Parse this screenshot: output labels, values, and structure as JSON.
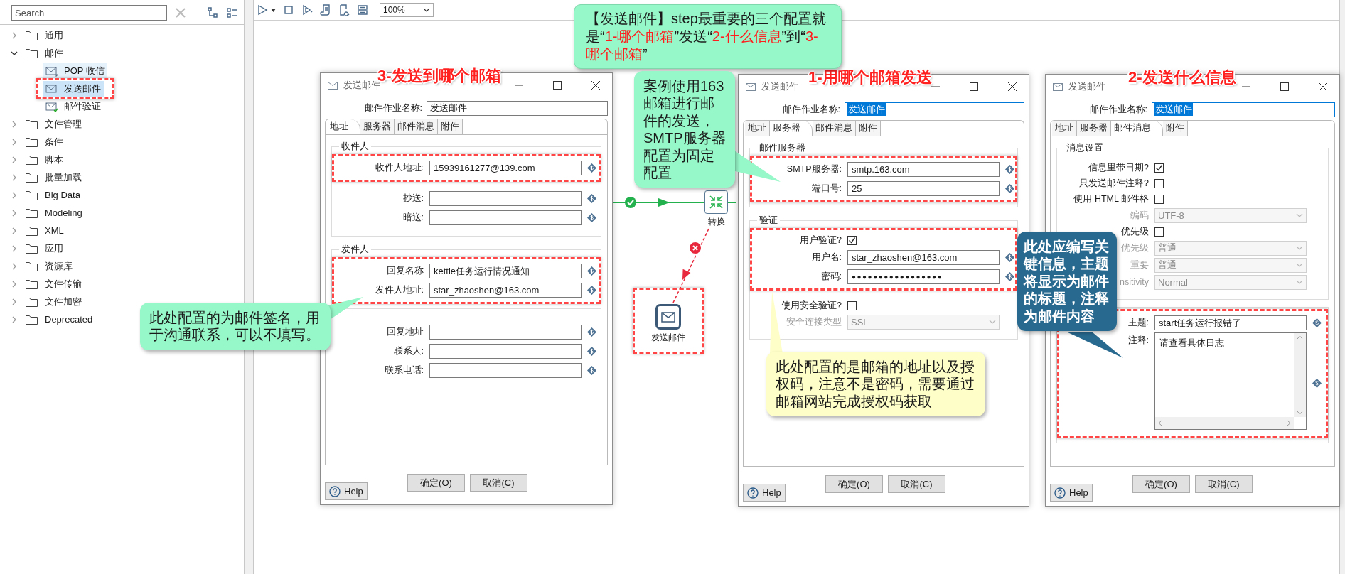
{
  "sidebar": {
    "search": {
      "placeholder": "Search"
    },
    "tree": [
      {
        "label": "通用",
        "expanded": false
      },
      {
        "label": "邮件",
        "expanded": true,
        "children": [
          {
            "label": "POP 收信",
            "kind": "receive",
            "selected": false,
            "hovered": true,
            "annotated": false
          },
          {
            "label": "发送邮件",
            "kind": "send",
            "selected": true,
            "hovered": false,
            "annotated": true
          },
          {
            "label": "邮件验证",
            "kind": "verify",
            "selected": false,
            "hovered": false,
            "annotated": false
          }
        ]
      },
      {
        "label": "文件管理",
        "expanded": false
      },
      {
        "label": "条件",
        "expanded": false
      },
      {
        "label": "脚本",
        "expanded": false
      },
      {
        "label": "批量加载",
        "expanded": false
      },
      {
        "label": "Big Data",
        "expanded": false
      },
      {
        "label": "Modeling",
        "expanded": false
      },
      {
        "label": "XML",
        "expanded": false
      },
      {
        "label": "应用",
        "expanded": false
      },
      {
        "label": "资源库",
        "expanded": false
      },
      {
        "label": "文件传输",
        "expanded": false
      },
      {
        "label": "文件加密",
        "expanded": false
      },
      {
        "label": "Deprecated",
        "expanded": false
      }
    ]
  },
  "toolbar": {
    "zoom": "100%"
  },
  "canvas": {
    "hops": [
      {
        "kind": "success"
      },
      {
        "kind": "error"
      }
    ],
    "nodes": [
      {
        "label": "转换",
        "kind": "transform",
        "annotated": false
      },
      {
        "label": "发送邮件",
        "kind": "mail",
        "annotated": true
      }
    ]
  },
  "banner": {
    "color": "#96f7c8",
    "segments": [
      {
        "text": "【发送邮件】step最重要的三个配置就是“",
        "emphasis": false
      },
      {
        "text": "1-哪个邮箱",
        "emphasis": true
      },
      {
        "text": "”发送“",
        "emphasis": false
      },
      {
        "text": "2-什么信息",
        "emphasis": true
      },
      {
        "text": "”到“",
        "emphasis": false
      },
      {
        "text": "3-哪个邮箱",
        "emphasis": true
      },
      {
        "text": "”",
        "emphasis": false
      }
    ]
  },
  "callouts": [
    {
      "text": "案例使用163邮箱进行邮件的发送，SMTP服务器配置为固定配置",
      "color": "#96f7c8"
    },
    {
      "text": "此处应编写关键信息，主题将显示为邮件的标题，注释为邮件内容",
      "color": "#28698f"
    },
    {
      "text": "此处配置的为邮件签名，用于沟通联系，可以不填写。",
      "color": "#96f7c8"
    },
    {
      "text": "此处配置的是邮箱的地址以及授权码，注意不是密码，需要通过邮箱网站完成授权码获取",
      "color": "#fefec8"
    }
  ],
  "dialogs": [
    {
      "title": "发送邮件",
      "heading": "3-发送到哪个邮箱",
      "name_field": {
        "label": "邮件作业名称:",
        "value": "发送邮件",
        "focused": false
      },
      "tabs": [
        {
          "label": "地址",
          "selected": true
        },
        {
          "label": "服务器",
          "selected": false
        },
        {
          "label": "邮件消息",
          "selected": false
        },
        {
          "label": "附件",
          "selected": false
        }
      ],
      "sections": [
        {
          "title": "收件人",
          "framed": true,
          "blocks": [
            {
              "highlighted": true,
              "rows": [
                {
                  "kind": "text",
                  "label": "收件人地址:",
                  "value": "15939161277@139.com"
                }
              ]
            },
            {
              "highlighted": false,
              "rows": [
                {
                  "kind": "text",
                  "label": "抄送:"
                },
                {
                  "kind": "text",
                  "label": "暗送:"
                }
              ]
            }
          ]
        },
        {
          "title": "发件人",
          "framed": true,
          "blocks": [
            {
              "highlighted": true,
              "rows": [
                {
                  "kind": "text",
                  "label": "回复名称",
                  "value": "kettle任务运行情况通知"
                },
                {
                  "kind": "text",
                  "label": "发件人地址:",
                  "value": "star_zhaoshen@163.com"
                }
              ]
            }
          ]
        },
        {
          "framed": false,
          "blocks": [
            {
              "highlighted": false,
              "rows": [
                {
                  "kind": "text",
                  "label": "回复地址"
                },
                {
                  "kind": "text",
                  "label": "联系人:"
                },
                {
                  "kind": "text",
                  "label": "联系电话:"
                }
              ]
            }
          ]
        }
      ],
      "buttons": {
        "help": "Help",
        "ok": "确定(O)",
        "cancel": "取消(C)"
      }
    },
    {
      "title": "发送邮件",
      "heading": "1-用哪个邮箱发送",
      "name_field": {
        "label": "邮件作业名称:",
        "value": "发送邮件",
        "focused": true
      },
      "tabs": [
        {
          "label": "地址",
          "selected": false
        },
        {
          "label": "服务器",
          "selected": true
        },
        {
          "label": "邮件消息",
          "selected": false
        },
        {
          "label": "附件",
          "selected": false
        }
      ],
      "sections": [
        {
          "title": "邮件服务器",
          "framed": true,
          "blocks": [
            {
              "highlighted": true,
              "rows": [
                {
                  "kind": "text",
                  "label": "SMTP服务器:",
                  "value": "smtp.163.com"
                },
                {
                  "kind": "text",
                  "label": "端口号:",
                  "value": "25"
                }
              ]
            }
          ]
        },
        {
          "title": "验证",
          "framed": true,
          "blocks": [
            {
              "highlighted": true,
              "rows": [
                {
                  "kind": "checkbox",
                  "label": "用户验证?",
                  "checked": true
                },
                {
                  "kind": "text",
                  "label": "用户名:",
                  "value": "star_zhaoshen@163.com"
                },
                {
                  "kind": "password",
                  "label": "密码:",
                  "value": "●●●●●●●●●●●●●●●●●"
                }
              ]
            },
            {
              "highlighted": false,
              "rows": [
                {
                  "kind": "checkbox",
                  "label": "使用安全验证?",
                  "checked": false
                },
                {
                  "kind": "select",
                  "label": "安全连接类型",
                  "value": "SSL",
                  "disabled": true
                }
              ]
            }
          ]
        }
      ],
      "buttons": {
        "help": "Help",
        "ok": "确定(O)",
        "cancel": "取消(C)"
      }
    },
    {
      "title": "发送邮件",
      "heading": "2-发送什么信息",
      "name_field": {
        "label": "邮件作业名称:",
        "value": "发送邮件",
        "focused": true
      },
      "tabs": [
        {
          "label": "地址",
          "selected": false
        },
        {
          "label": "服务器",
          "selected": false
        },
        {
          "label": "邮件消息",
          "selected": true
        },
        {
          "label": "附件",
          "selected": false
        }
      ],
      "sections": [
        {
          "title": "消息设置",
          "framed": true,
          "blocks": [
            {
              "highlighted": false,
              "rows": [
                {
                  "kind": "checkbox",
                  "label": "信息里带日期?",
                  "checked": true
                },
                {
                  "kind": "checkbox",
                  "label": "只发送邮件注释?",
                  "checked": false
                },
                {
                  "kind": "checkbox",
                  "label": "使用 HTML 邮件格",
                  "checked": false
                },
                {
                  "kind": "select",
                  "label": "编码",
                  "value": "UTF-8",
                  "disabled": true
                },
                {
                  "kind": "checkbox",
                  "label": "优先级",
                  "checked": false
                },
                {
                  "kind": "select",
                  "label": "优先级",
                  "value": "普通",
                  "disabled": true
                },
                {
                  "kind": "select",
                  "label": "重要",
                  "value": "普通",
                  "disabled": true
                },
                {
                  "kind": "select",
                  "label": "nsitivity",
                  "value": "Normal",
                  "disabled": true
                }
              ]
            }
          ]
        },
        {
          "framed": true,
          "blocks": [
            {
              "highlighted": true,
              "rows": [
                {
                  "kind": "text",
                  "label": "主题:",
                  "value": "start任务运行报错了"
                },
                {
                  "kind": "textarea",
                  "label": "注释:",
                  "value": "请查看具体日志"
                }
              ]
            }
          ]
        }
      ],
      "buttons": {
        "help": "Help",
        "ok": "确定(O)",
        "cancel": "取消(C)"
      }
    }
  ]
}
